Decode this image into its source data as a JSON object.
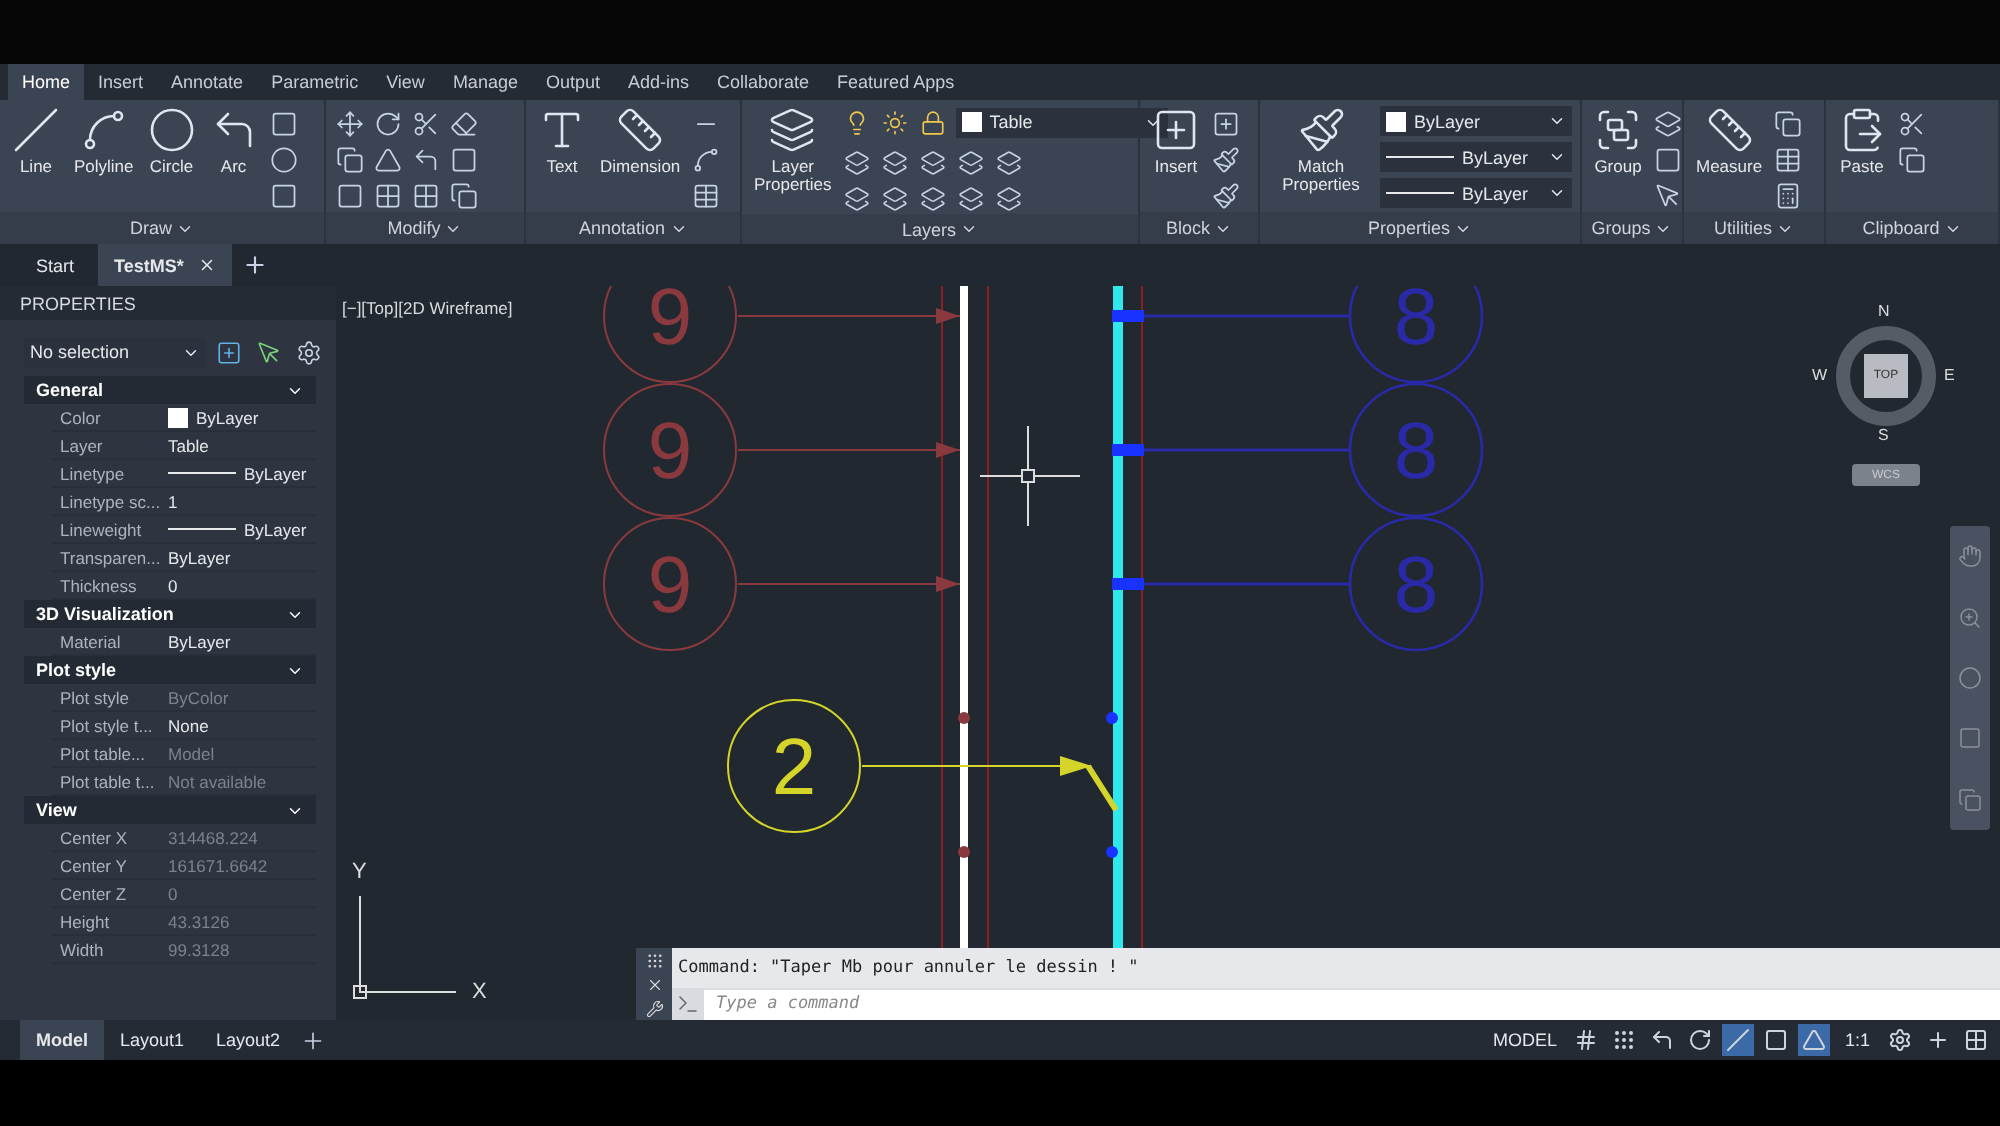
{
  "ribbon_tabs": [
    {
      "label": "Home",
      "selected": true
    },
    {
      "label": "Insert",
      "selected": false
    },
    {
      "label": "Annotate",
      "selected": false
    },
    {
      "label": "Parametric",
      "selected": false
    },
    {
      "label": "View",
      "selected": false
    },
    {
      "label": "Manage",
      "selected": false
    },
    {
      "label": "Output",
      "selected": false
    },
    {
      "label": "Add-ins",
      "selected": false
    },
    {
      "label": "Collaborate",
      "selected": false
    },
    {
      "label": "Featured Apps",
      "selected": false
    }
  ],
  "ribbon_panels": [
    {
      "title": "Draw",
      "tools": [
        "Line",
        "Polyline",
        "Circle",
        "Arc"
      ]
    },
    {
      "title": "Modify"
    },
    {
      "title": "Annotation",
      "tools": [
        "Text",
        "Dimension"
      ]
    },
    {
      "title": "Layers",
      "tools": [
        "Layer Properties"
      ],
      "layer": "Table"
    },
    {
      "title": "Block",
      "tools": [
        "Insert"
      ]
    },
    {
      "title": "Properties",
      "tools": [
        "Match Properties"
      ],
      "dropdowns": [
        "ByLayer",
        "ByLayer",
        "ByLayer"
      ]
    },
    {
      "title": "Groups",
      "tools": [
        "Group"
      ]
    },
    {
      "title": "Utilities",
      "tools": [
        "Measure"
      ]
    },
    {
      "title": "Clipboard",
      "tools": [
        "Paste"
      ]
    }
  ],
  "doc_tabs": [
    {
      "label": "Start",
      "selected": false,
      "closable": false
    },
    {
      "label": "TestMS*",
      "selected": true,
      "closable": true
    }
  ],
  "properties": {
    "title": "PROPERTIES",
    "selection": "No selection",
    "sections": [
      {
        "title": "General",
        "rows": [
          {
            "label": "Color",
            "value": "ByLayer",
            "kind": "color",
            "disabled": false
          },
          {
            "label": "Layer",
            "value": "Table",
            "kind": "text",
            "disabled": false
          },
          {
            "label": "Linetype",
            "value": "ByLayer",
            "kind": "line",
            "disabled": false
          },
          {
            "label": "Linetype sc...",
            "value": "1",
            "kind": "text",
            "disabled": false
          },
          {
            "label": "Lineweight",
            "value": "ByLayer",
            "kind": "line",
            "disabled": false
          },
          {
            "label": "Transparen...",
            "value": "ByLayer",
            "kind": "text",
            "disabled": false
          },
          {
            "label": "Thickness",
            "value": "0",
            "kind": "text",
            "disabled": false
          }
        ]
      },
      {
        "title": "3D Visualization",
        "rows": [
          {
            "label": "Material",
            "value": "ByLayer",
            "kind": "text",
            "disabled": false
          }
        ]
      },
      {
        "title": "Plot style",
        "rows": [
          {
            "label": "Plot style",
            "value": "ByColor",
            "kind": "text",
            "disabled": true
          },
          {
            "label": "Plot style t...",
            "value": "None",
            "kind": "text",
            "disabled": false
          },
          {
            "label": "Plot table...",
            "value": "Model",
            "kind": "text",
            "disabled": true
          },
          {
            "label": "Plot table t...",
            "value": "Not available",
            "kind": "text",
            "disabled": true
          }
        ]
      },
      {
        "title": "View",
        "rows": [
          {
            "label": "Center X",
            "value": "314468.224",
            "kind": "text",
            "disabled": true
          },
          {
            "label": "Center Y",
            "value": "161671.6642",
            "kind": "text",
            "disabled": true
          },
          {
            "label": "Center Z",
            "value": "0",
            "kind": "text",
            "disabled": true
          },
          {
            "label": "Height",
            "value": "43.3126",
            "kind": "text",
            "disabled": true
          },
          {
            "label": "Width",
            "value": "99.3128",
            "kind": "text",
            "disabled": true
          }
        ]
      }
    ]
  },
  "viewport": {
    "label": "[−][Top][2D Wireframe]",
    "compass": {
      "north": "N",
      "south": "S",
      "east": "E",
      "west": "W",
      "face": "TOP",
      "ucs": "WCS"
    },
    "axes": {
      "y": "Y",
      "x": "X"
    }
  },
  "balloons": [
    {
      "number": "9",
      "color": "#8a3a3e",
      "kind": "left"
    },
    {
      "number": "9",
      "color": "#8a3a3e",
      "kind": "left"
    },
    {
      "number": "9",
      "color": "#8a3a3e",
      "kind": "left"
    },
    {
      "number": "8",
      "color": "#2a2aa8",
      "kind": "right"
    },
    {
      "number": "8",
      "color": "#2a2aa8",
      "kind": "right"
    },
    {
      "number": "8",
      "color": "#2a2aa8",
      "kind": "right"
    },
    {
      "number": "2",
      "color": "#d4d42a",
      "kind": "leader"
    }
  ],
  "command": {
    "history": "Command: \"Taper Mb pour annuler le dessin ! \"",
    "placeholder": "Type a command"
  },
  "layout_tabs": [
    {
      "label": "Model",
      "selected": true
    },
    {
      "label": "Layout1",
      "selected": false
    },
    {
      "label": "Layout2",
      "selected": false
    }
  ],
  "status": {
    "space": "MODEL",
    "scale": "1:1"
  }
}
